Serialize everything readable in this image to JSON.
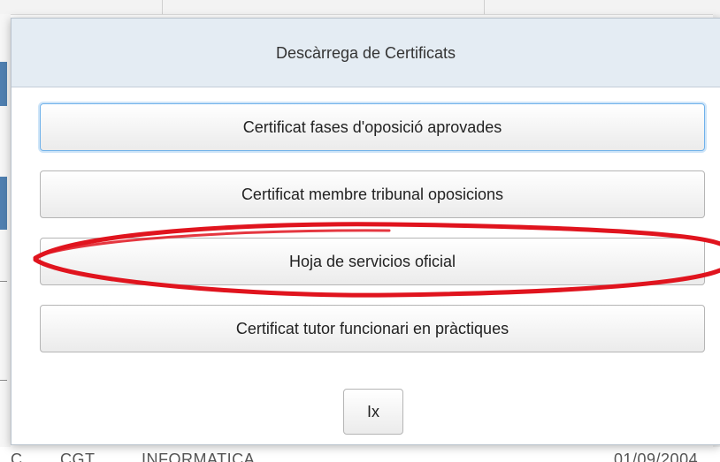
{
  "background": {
    "bottom_row_left_fragment": "C",
    "bottom_row_code": "CGT",
    "bottom_row_department": "INFORMATICA",
    "bottom_row_date": "01/09/2004"
  },
  "dialog": {
    "title": "Descàrrega de Certificats",
    "buttons": [
      {
        "label": "Certificat fases d'oposició aprovades"
      },
      {
        "label": "Certificat membre tribunal oposicions"
      },
      {
        "label": "Hoja de servicios oficial"
      },
      {
        "label": "Certificat tutor funcionari en pràctiques"
      }
    ],
    "close_label": "Ix"
  },
  "annotation": {
    "target": "Hoja de servicios oficial",
    "color": "#e0141e"
  },
  "colors": {
    "header_bg": "#e4ecf3",
    "focus_ring": "#6fb1ea",
    "background_accent": "#4f7fb0"
  }
}
